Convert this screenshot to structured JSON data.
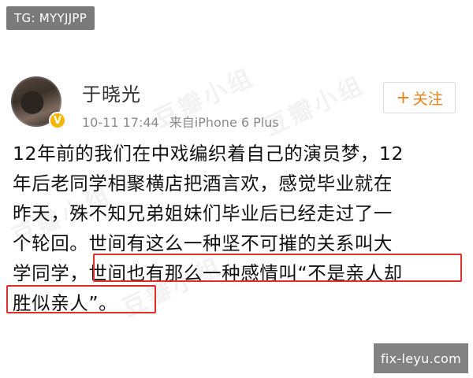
{
  "tag": {
    "label": "TG: MYYJJPP"
  },
  "post": {
    "username": "于晓光",
    "timestamp": "10-11 17:44",
    "source": "来自iPhone 6 Plus",
    "follow_button": {
      "plus": "+",
      "label": "关注"
    },
    "verified_mark": "V",
    "lines": [
      "12年前的我们在中戏编织着自己的演员梦，12",
      "年后老同学相聚横店把酒言欢，感觉毕业就在",
      "昨天，殊不知兄弟姐妹们毕业后已经走过了一",
      "个轮回。世间有这么一种坚不可摧的关系叫大",
      "学同学，世间也有那么一种感情叫“不是亲人却",
      "胜似亲人”。"
    ]
  },
  "watermarks": [
    "豆瓣小组",
    "豆瓣小组",
    "豆瓣小组",
    "豆瓣小组"
  ],
  "site_badge": {
    "label": "fix-leyu.com"
  },
  "colors": {
    "highlight": "#e02e2e",
    "follow": "#e8821e",
    "verified": "#f6b500"
  }
}
